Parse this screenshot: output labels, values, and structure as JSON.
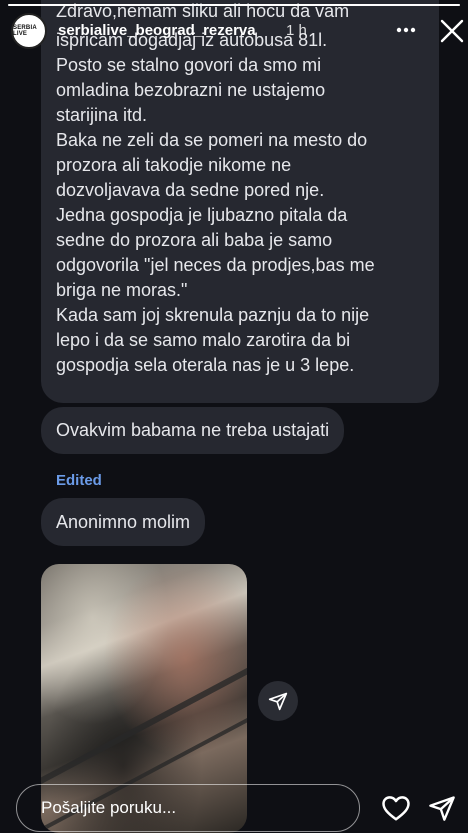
{
  "story": {
    "progress": 1.0
  },
  "header": {
    "avatar_text": "SERBIA LIVE",
    "username": "serbialive_beograd_rezerva",
    "time_ago": "1 h",
    "more_icon": "more-icon",
    "close_icon": "close-icon"
  },
  "messages": {
    "main_first_line": "Zdravo,nemam sliku ali hocu da vam ispricam dogadjaj iz autobusa 81l.",
    "main_lines": [
      "ispricam dogadjaj iz autobusa 81l.",
      "Posto se stalno govori da smo mi",
      "omladina bezobrazni ne ustajemo",
      "starijina itd.",
      "Baka ne zeli da se pomeri na mesto do",
      "prozora ali takodje nikome ne",
      "dozvoljavava da sedne pored nje.",
      "Jedna gospodja je ljubazno pitala da",
      "sedne do prozora ali baba je samo",
      "odgovorila \"jel neces da prodjes,bas me",
      "briga ne moras.\"",
      "Kada sam joj skrenula paznju da to nije",
      "lepo i da se samo malo zarotira da bi",
      "gospodja sela oterala nas je u 3 lepe."
    ],
    "main_top": "Zdravo,nemam sliku ali hocu da vam",
    "second": "Ovakvim babama ne treba ustajati",
    "edited_label": "Edited",
    "third": "Anonimno molim"
  },
  "photo": {
    "icon": "share-icon"
  },
  "footer": {
    "reply_placeholder": "Pošaljite poruku...",
    "heart_icon": "heart-icon",
    "send_icon": "send-icon"
  }
}
